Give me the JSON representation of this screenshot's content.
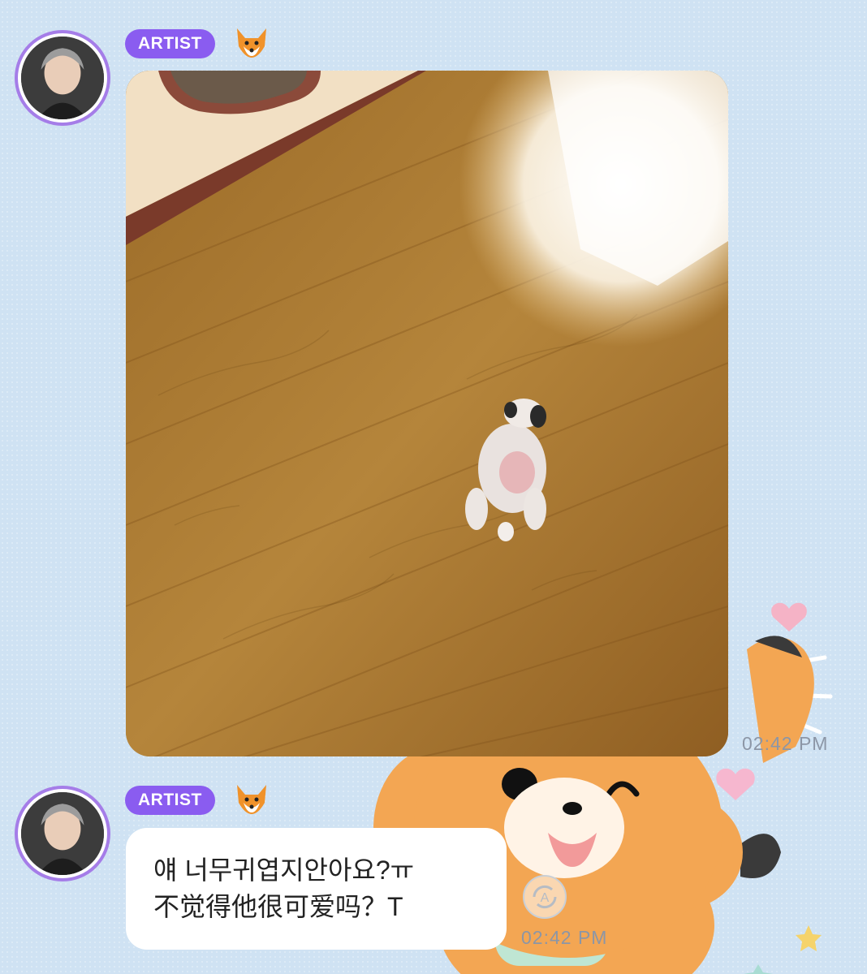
{
  "messages": [
    {
      "badge": "ARTIST",
      "type": "image",
      "image_description": "",
      "time": "02:42 PM"
    },
    {
      "badge": "ARTIST",
      "type": "text",
      "lines": [
        "얘 너무귀엽지안아요?ㅠ",
        "不觉得他很可爱吗？T"
      ],
      "time": "02:42 PM"
    }
  ],
  "icons": {
    "fox": "fox-emoji-icon",
    "translate": "translate-icon"
  },
  "colors": {
    "background": "#cfe2f3",
    "badge": "#8a5cf0",
    "avatar_ring": "#a57de8",
    "time_text": "#8c96a6"
  }
}
